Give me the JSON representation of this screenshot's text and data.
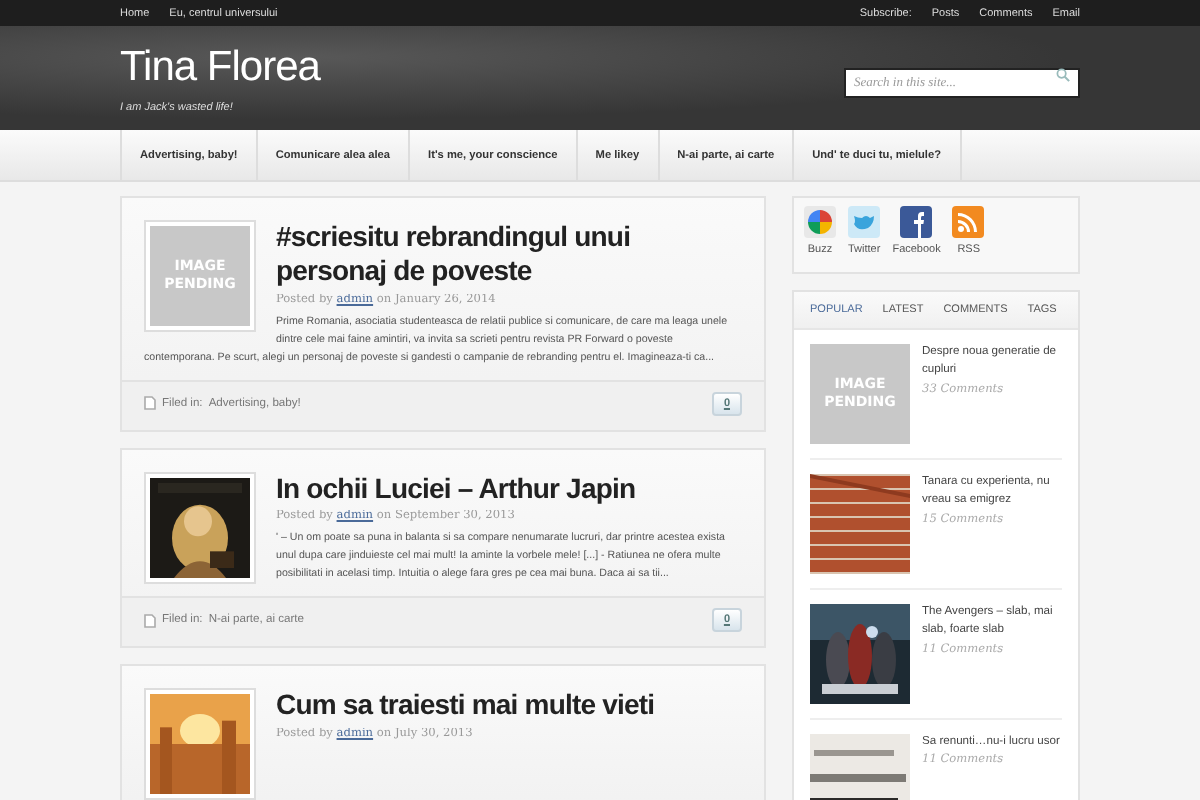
{
  "top_bar": {
    "links": [
      "Home",
      "Eu, centrul universului"
    ],
    "subscribe_label": "Subscribe:",
    "subscribe_links": [
      "Posts",
      "Comments",
      "Email"
    ]
  },
  "header": {
    "title": "Tina Florea",
    "tagline": "I am Jack's wasted life!",
    "search": {
      "placeholder": "Search in this site..."
    }
  },
  "nav": [
    "Advertising, baby!",
    "Comunicare alea alea",
    "It's me, your conscience",
    "Me likey",
    "N-ai parte, ai carte",
    "Und' te duci tu, mielule?"
  ],
  "posts": [
    {
      "title": "#scriesitu rebrandingul unui personaj de poveste",
      "thumb": {
        "kind": "pending",
        "text": "IMAGE PENDING"
      },
      "posted_by": "Posted by",
      "author": "admin",
      "date_prefix": "on",
      "date": "January 26, 2014",
      "excerpt": "Prime Romania, asociatia studenteasca de relatii publice si comunicare, de care ma leaga unele dintre cele mai faine amintiri, va invita sa scrieti pentru revista PR Forward o poveste contemporana. Pe scurt, alegi un personaj de poveste si gandesti o campanie de rebranding pentru el. Imagineaza-ti ca...",
      "filed_label": "Filed in:",
      "category": "Advertising, baby!",
      "comments": "0"
    },
    {
      "title": "In ochii Luciei – Arthur Japin",
      "thumb": {
        "kind": "book"
      },
      "posted_by": "Posted by",
      "author": "admin",
      "date_prefix": "on",
      "date": "September 30, 2013",
      "excerpt": "' –  Un om poate sa puna in balanta si sa compare nenumarate lucruri, dar printre acestea exista unul dupa care jinduieste cel mai mult! Ia aminte la vorbele mele! [...] - Ratiunea ne ofera multe posibilitati in acelasi timp. Intuitia o alege fara gres pe cea mai buna. Daca ai sa tii...",
      "filed_label": "Filed in:",
      "category": "N-ai parte, ai carte",
      "comments": "0"
    },
    {
      "title": "Cum sa traiesti mai multe vieti",
      "thumb": {
        "kind": "sunset"
      },
      "posted_by": "Posted by",
      "author": "admin",
      "date_prefix": "on",
      "date": "July 30, 2013"
    }
  ],
  "social": [
    {
      "kind": "buzz",
      "label": "Buzz"
    },
    {
      "kind": "twitter",
      "label": "Twitter"
    },
    {
      "kind": "facebook",
      "label": "Facebook"
    },
    {
      "kind": "rss",
      "label": "RSS"
    }
  ],
  "tabs": [
    {
      "label": "POPULAR",
      "selected": true
    },
    {
      "label": "LATEST",
      "selected": false
    },
    {
      "label": "COMMENTS",
      "selected": false
    },
    {
      "label": "TAGS",
      "selected": false
    }
  ],
  "popular": [
    {
      "title": "Despre noua generatie de cupluri",
      "comments": "33 Comments",
      "thumb": {
        "kind": "pending",
        "text": "IMAGE PENDING"
      }
    },
    {
      "title": "Tanara cu experienta, nu vreau sa emigrez",
      "comments": "15 Comments",
      "thumb": {
        "kind": "brick"
      }
    },
    {
      "title": "The Avengers – slab, mai slab, foarte slab",
      "comments": "11 Comments",
      "thumb": {
        "kind": "movie"
      }
    },
    {
      "title": "Sa renunti…nu-i lucru usor",
      "comments": "11 Comments",
      "thumb": {
        "kind": "paper"
      }
    }
  ]
}
